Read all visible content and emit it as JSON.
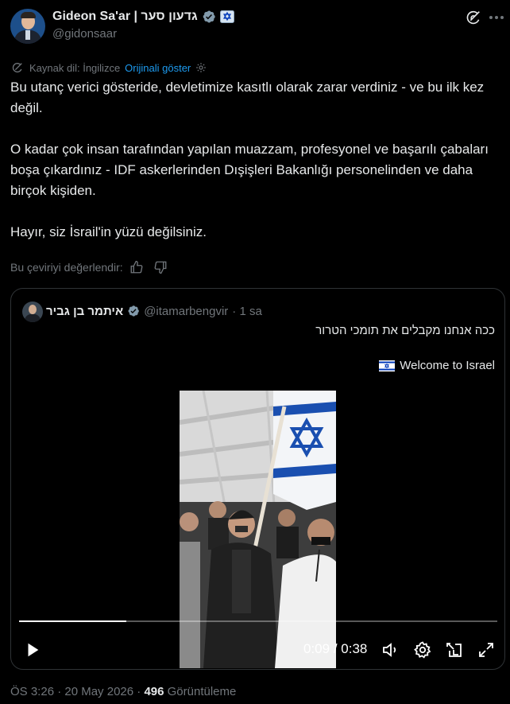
{
  "author": {
    "name": "Gideon Sa'ar | גדעון סער",
    "handle": "@gidonsaar"
  },
  "translation": {
    "source_label": "Kaynak dil: İngilizce",
    "show_original": "Orijinali göster",
    "rate_label": "Bu çeviriyi değerlendir:"
  },
  "tweet": {
    "paragraphs": [
      "Bu utanç verici gösteride, devletimize kasıtlı olarak zarar verdiniz - ve bu ilk kez değil.",
      "O kadar çok insan tarafından yapılan muazzam, profesyonel ve başarılı çabaları boşa çıkardınız - IDF askerlerinden Dışişleri Bakanlığı personelinden ve daha birçok kişiden.",
      "Hayır, siz İsrail'in yüzü değilsiniz."
    ]
  },
  "quote": {
    "name": "איתמר בן גביר",
    "handle": "@itamarbengvir",
    "time": "· 1 sa",
    "text_line1": "ככה אנחנו מקבלים את תומכי הטרור",
    "text_line2": "Welcome to Israel",
    "video": {
      "current_time": "0:09",
      "separator": "/",
      "duration": "0:38",
      "progress": 0.225
    }
  },
  "footer": {
    "time": "ÖS 3:26 · 20 May 2026 ·",
    "views_count": "496",
    "views_label": "Görüntüleme"
  },
  "colors": {
    "background": "#000000",
    "text": "#e7e9ea",
    "secondary": "#71767b",
    "link": "#1d9bf0",
    "border": "#2f3336",
    "israel_blue": "#0038b8"
  }
}
